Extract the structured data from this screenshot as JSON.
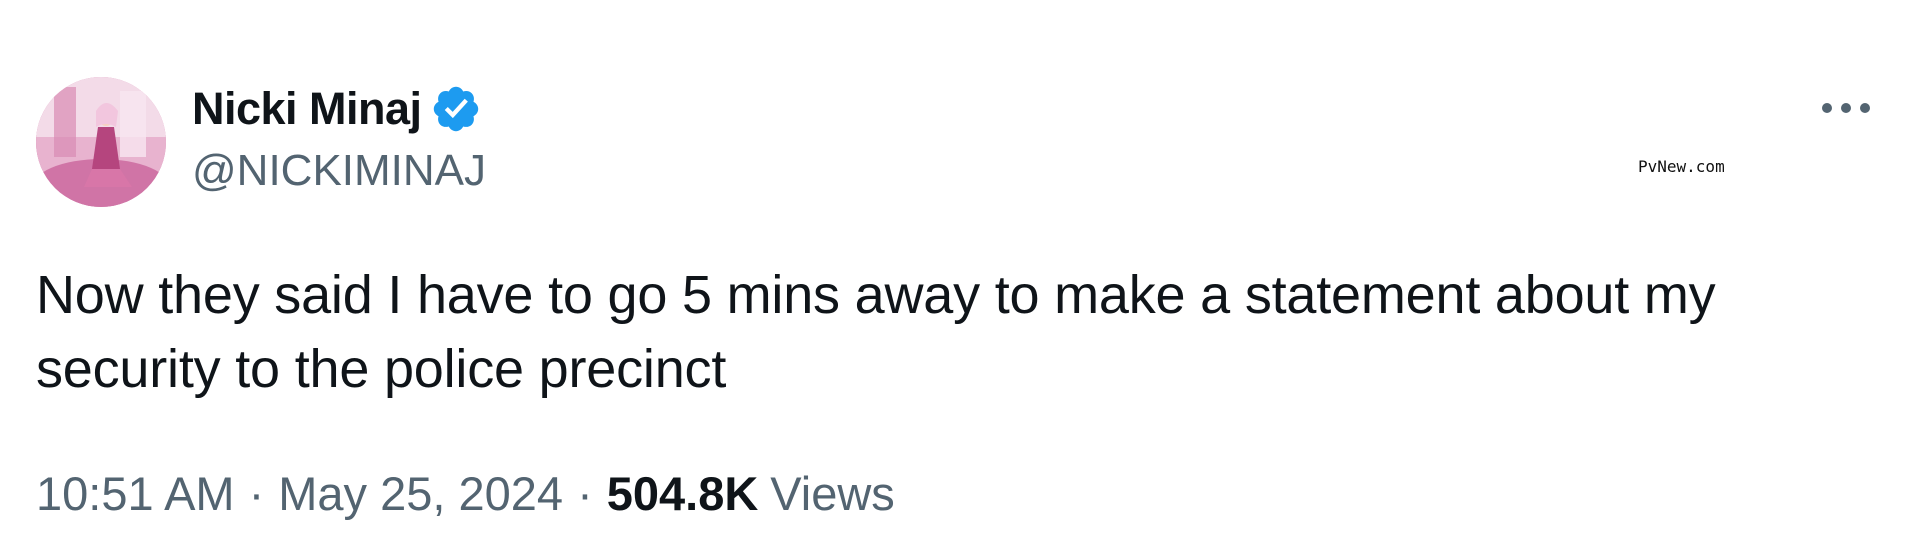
{
  "author": {
    "display_name": "Nicki Minaj",
    "handle": "@NICKIMINAJ",
    "verified_icon": "verified-badge-icon",
    "verified_color": "#1d9bf0"
  },
  "watermark": "PvNew.com",
  "more_icon": "more-horizontal-icon",
  "tweet": {
    "text": "Now they said I have to go 5 mins away to make a statement about my security to the police precinct"
  },
  "meta": {
    "time": "10:51 AM",
    "separator": "·",
    "date": "May 25, 2024",
    "views_count": "504.8K",
    "views_label": "Views"
  },
  "colors": {
    "text_primary": "#0f1419",
    "text_secondary": "#536471",
    "background": "#ffffff"
  }
}
